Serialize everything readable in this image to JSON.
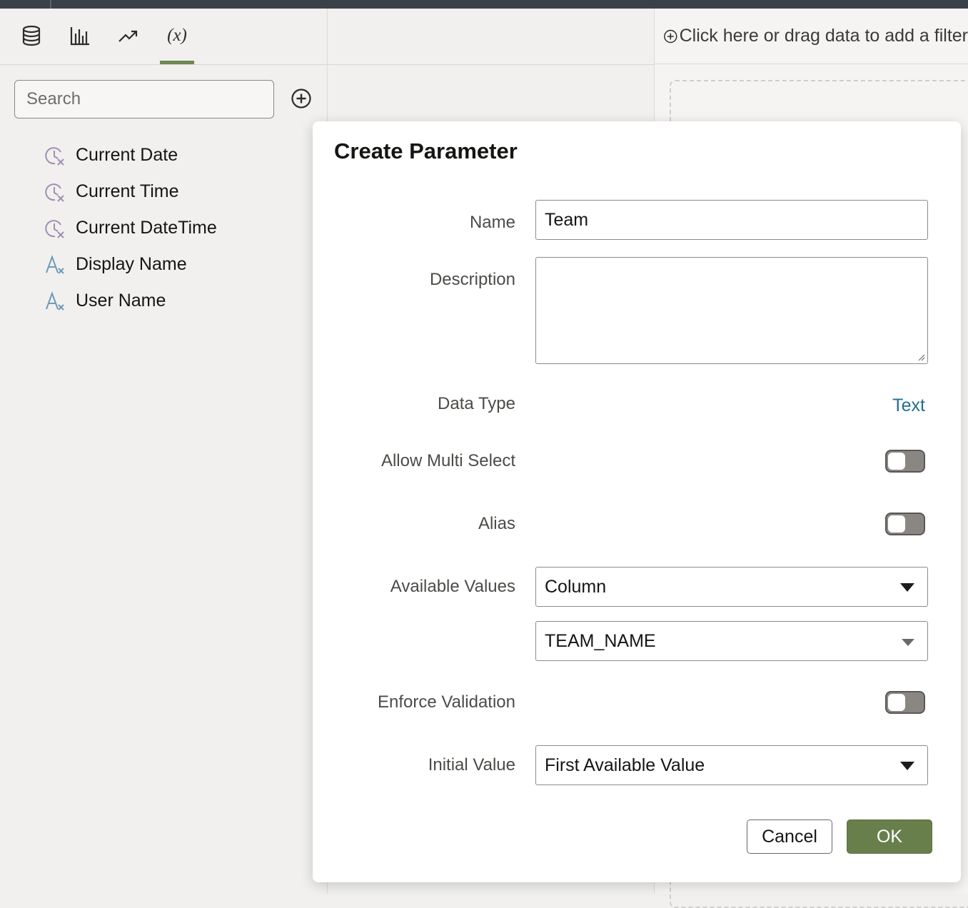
{
  "left_panel": {
    "tabs": [
      {
        "name": "data",
        "icon": "database-icon"
      },
      {
        "name": "visualizations",
        "icon": "bar-chart-icon"
      },
      {
        "name": "analytics",
        "icon": "trend-icon"
      },
      {
        "name": "parameters",
        "label": "(x)",
        "icon": "parameter-icon",
        "active": true
      }
    ],
    "search_placeholder": "Search",
    "variables": [
      {
        "label": "Current Date",
        "icon": "clock-variable-icon"
      },
      {
        "label": "Current Time",
        "icon": "clock-variable-icon"
      },
      {
        "label": "Current DateTime",
        "icon": "clock-variable-icon"
      },
      {
        "label": "Display Name",
        "icon": "text-variable-icon"
      },
      {
        "label": "User Name",
        "icon": "text-variable-icon"
      }
    ]
  },
  "filter_bar": {
    "placeholder": "Click here or drag data to add a filter"
  },
  "dialog": {
    "title": "Create Parameter",
    "name_label": "Name",
    "name_value": "Team",
    "description_label": "Description",
    "description_value": "",
    "data_type_label": "Data Type",
    "data_type_value": "Text",
    "allow_multi_select_label": "Allow Multi Select",
    "allow_multi_select": false,
    "alias_label": "Alias",
    "alias": false,
    "available_values_label": "Available Values",
    "available_values": "Column",
    "column_value": "TEAM_NAME",
    "enforce_validation_label": "Enforce Validation",
    "enforce_validation": false,
    "initial_value_label": "Initial Value",
    "initial_value": "First Available Value",
    "cancel_label": "Cancel",
    "ok_label": "OK"
  },
  "colors": {
    "accent_green": "#687f4c",
    "link_blue": "#227093",
    "clock_icon": "#a08fb3",
    "text_icon": "#6d9ab8"
  }
}
